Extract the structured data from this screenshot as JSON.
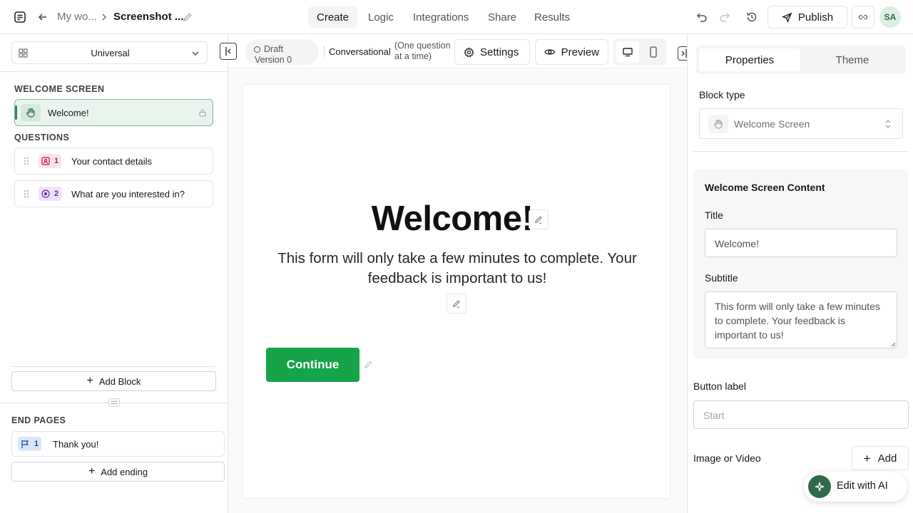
{
  "header": {
    "breadcrumb_parent": "My wo...",
    "breadcrumb_current": "Screenshot ...",
    "tabs": [
      {
        "label": "Create"
      },
      {
        "label": "Logic"
      },
      {
        "label": "Integrations"
      },
      {
        "label": "Share"
      },
      {
        "label": "Results"
      }
    ],
    "publish_label": "Publish",
    "avatar_initials": "SA"
  },
  "sidebar": {
    "workspace_select": "Universal",
    "welcome_heading": "WELCOME SCREEN",
    "welcome_item": "Welcome!",
    "questions_heading": "QUESTIONS",
    "questions": [
      {
        "number": "1",
        "label": "Your contact details",
        "icon": "contact-icon"
      },
      {
        "number": "2",
        "label": "What are you interested in?",
        "icon": "choice-icon"
      }
    ],
    "add_block_label": "Add Block",
    "end_pages_heading": "END PAGES",
    "end_pages": [
      {
        "number": "1",
        "label": "Thank you!",
        "icon": "flag-icon"
      }
    ],
    "add_ending_label": "Add ending"
  },
  "toolbar": {
    "draft_line1": "Draft",
    "draft_line2": "Version 0",
    "mode_label": "Conversational",
    "mode_desc_line1": "(One question",
    "mode_desc_line2": "at a time)",
    "settings_label": "Settings",
    "preview_label": "Preview"
  },
  "form": {
    "title": "Welcome!",
    "subtitle_line1": "This form will only take a few minutes to complete. Your",
    "subtitle_line2": "feedback is important to us!",
    "button_label": "Continue"
  },
  "properties": {
    "tabs": [
      {
        "label": "Properties"
      },
      {
        "label": "Theme"
      }
    ],
    "block_type_label": "Block type",
    "block_type_value": "Welcome Screen",
    "content_heading": "Welcome Screen Content",
    "title_label": "Title",
    "title_value": "Welcome!",
    "subtitle_label": "Subtitle",
    "subtitle_line1": "This form will only take a few minutes",
    "subtitle_line2": "to complete. Your feedback is",
    "subtitle_line3": "important to us!",
    "button_label_label": "Button label",
    "button_label_placeholder": "Start",
    "media_label": "Image or Video",
    "add_label": "Add",
    "ai_label": "Edit with AI"
  },
  "colors": {
    "accent_green": "#16a34a",
    "selected_bg": "#eaf4ef"
  }
}
